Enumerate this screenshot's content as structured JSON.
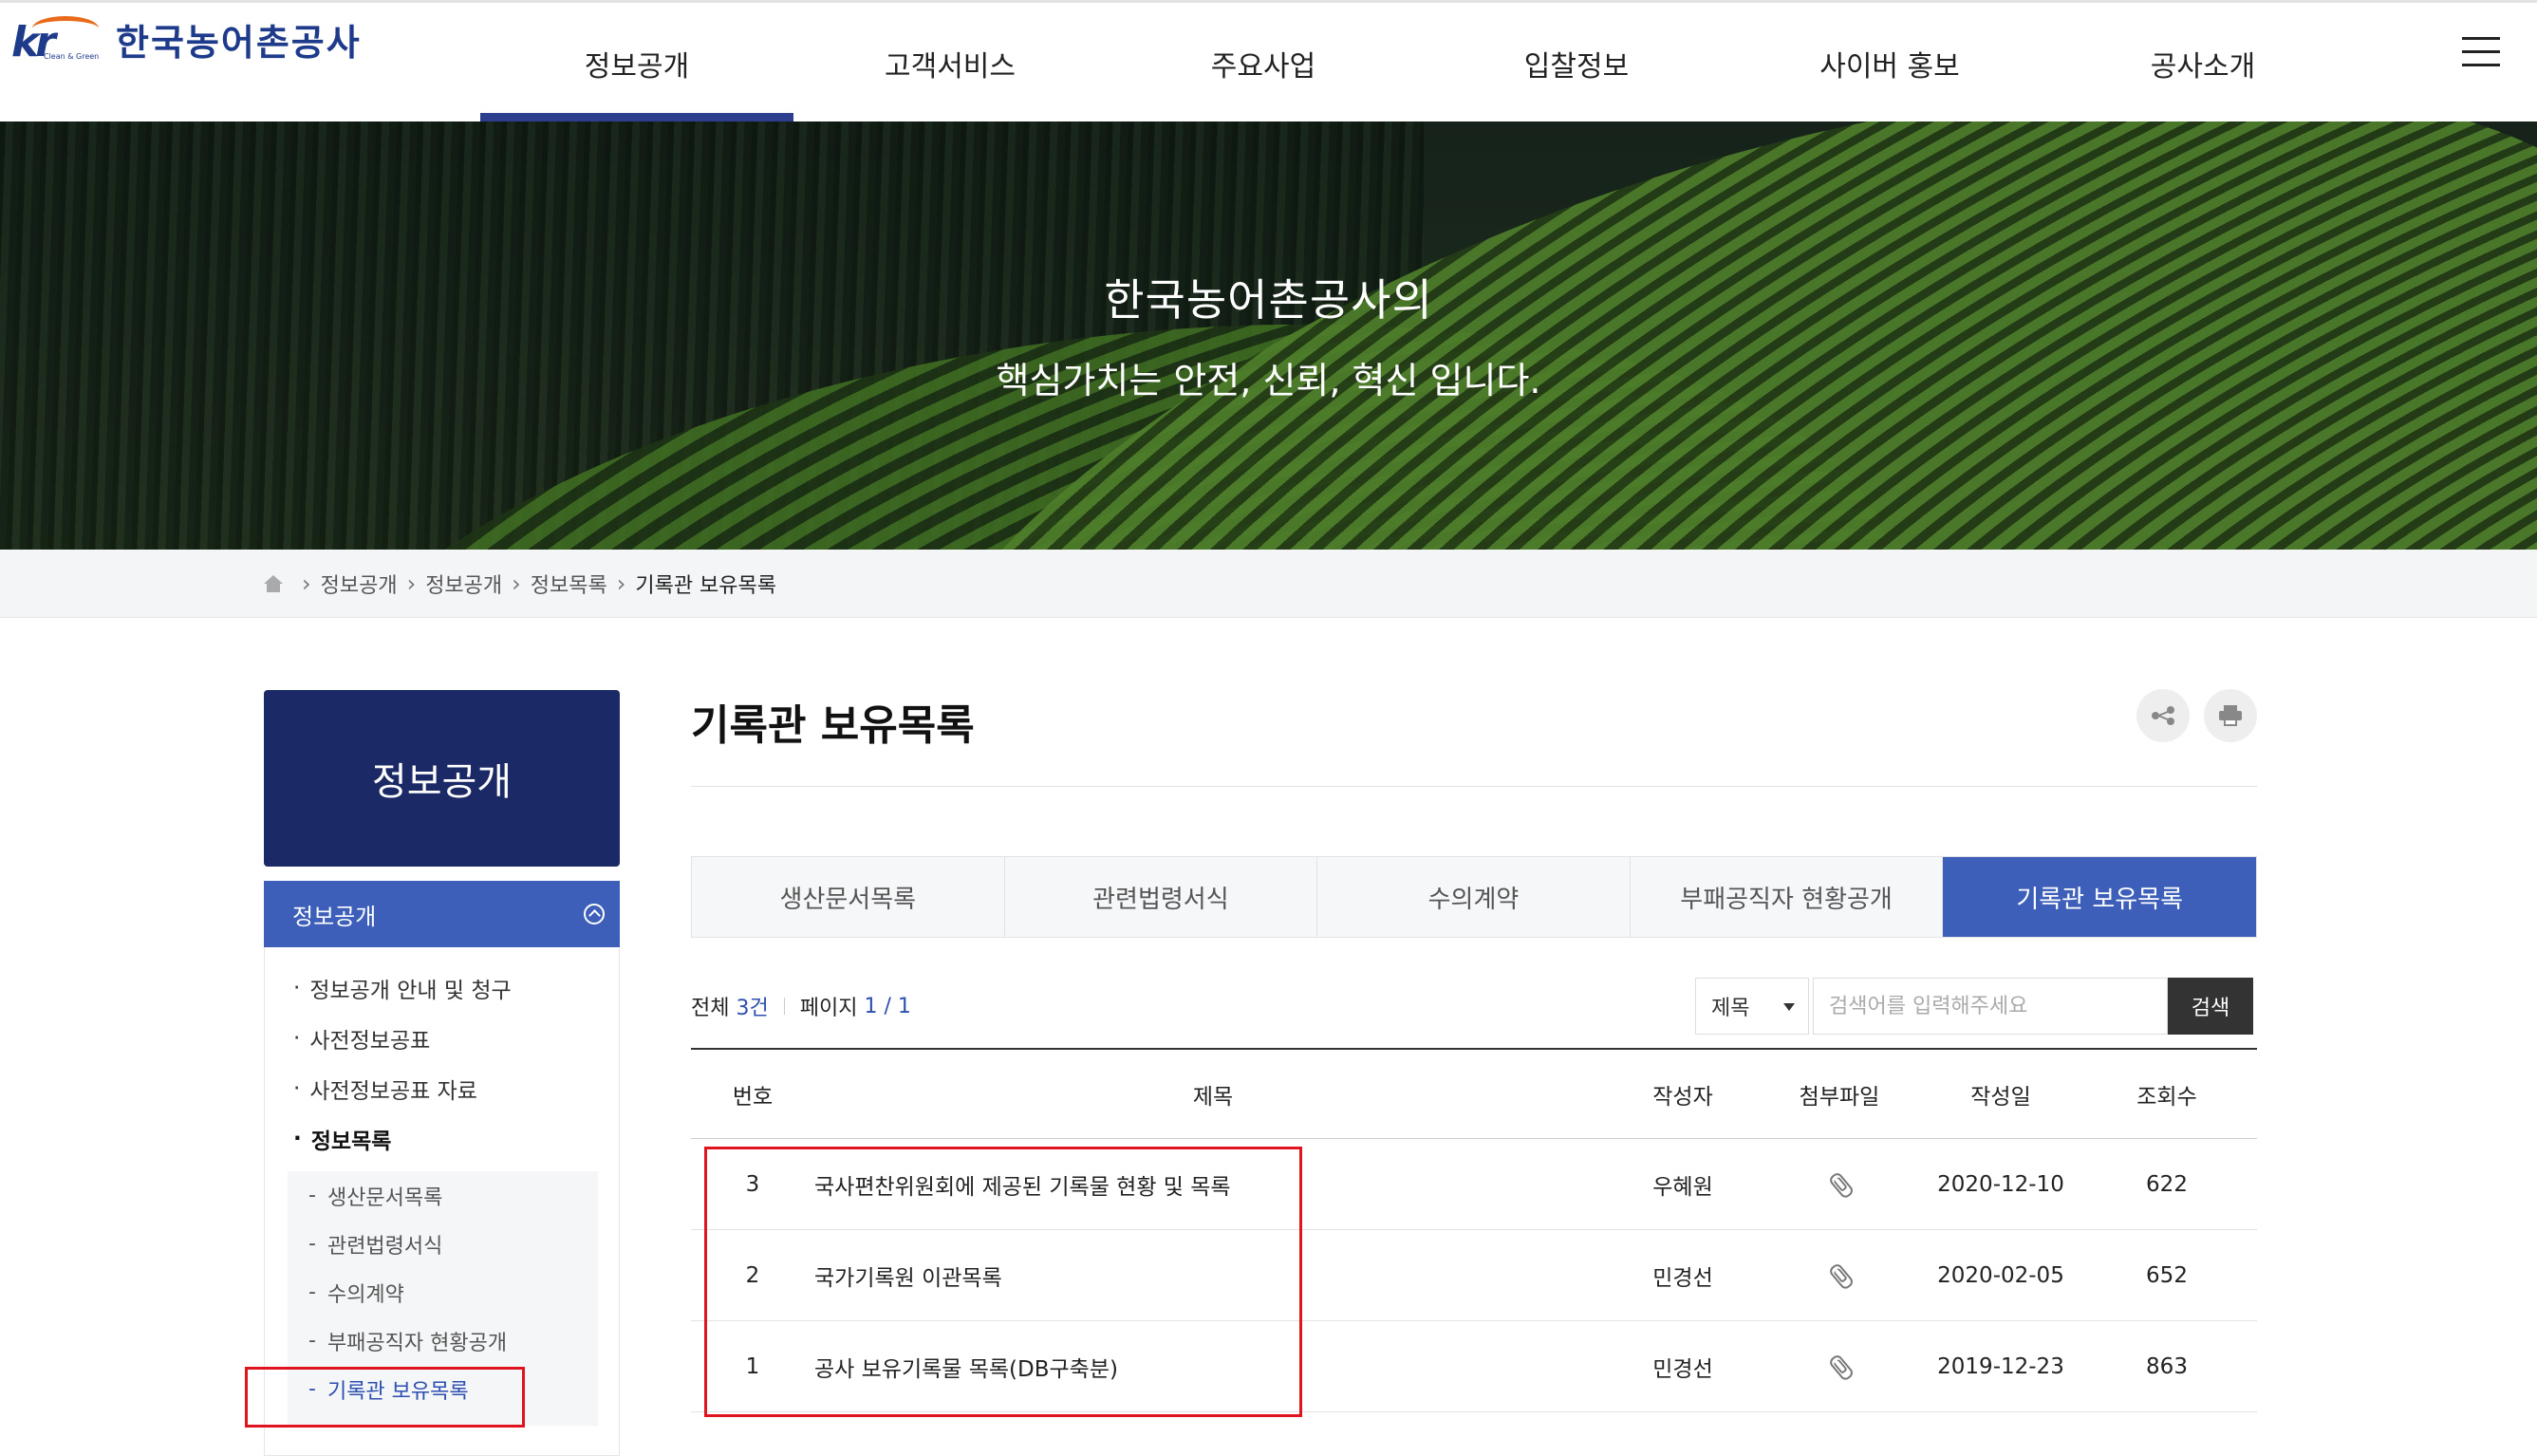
{
  "header": {
    "logo_mark": "kr",
    "logo_sub": "Clean & Green",
    "logo_text": "한국농어촌공사",
    "nav": [
      "정보공개",
      "고객서비스",
      "주요사업",
      "입찰정보",
      "사이버 홍보",
      "공사소개"
    ],
    "active_nav": "정보공개"
  },
  "banner": {
    "line1": "한국농어촌공사의",
    "line2": "핵심가치는 안전, 신뢰, 혁신 입니다."
  },
  "breadcrumb": [
    "정보공개",
    "정보공개",
    "정보목록",
    "기록관 보유목록"
  ],
  "sidebar": {
    "head": "정보공개",
    "category": "정보공개",
    "items": [
      {
        "label": "정보공개 안내 및 청구"
      },
      {
        "label": "사전정보공표"
      },
      {
        "label": "사전정보공표 자료"
      },
      {
        "label": "정보목록"
      }
    ],
    "sub_items": [
      {
        "label": "생산문서목록"
      },
      {
        "label": "관련법령서식"
      },
      {
        "label": "수의계약"
      },
      {
        "label": "부패공직자 현황공개"
      },
      {
        "label": "기록관 보유목록"
      }
    ]
  },
  "content": {
    "title": "기록관 보유목록",
    "tabs": [
      "생산문서목록",
      "관련법령서식",
      "수의계약",
      "부패공직자 현황공개",
      "기록관 보유목록"
    ],
    "active_tab": "기록관 보유목록",
    "count_prefix": "전체",
    "count_value": "3건",
    "page_prefix": "페이지",
    "page_current": "1",
    "page_sep": "/",
    "page_total": "1",
    "search": {
      "select_value": "제목",
      "placeholder": "검색어를 입력해주세요",
      "button": "검색"
    },
    "columns": [
      "번호",
      "제목",
      "작성자",
      "첨부파일",
      "작성일",
      "조회수"
    ],
    "rows": [
      {
        "no": "3",
        "title": "국사편찬위원회에 제공된 기록물 현황 및 목록",
        "author": "우혜원",
        "date": "2020-12-10",
        "views": "622"
      },
      {
        "no": "2",
        "title": "국가기록원 이관목록",
        "author": "민경선",
        "date": "2020-02-05",
        "views": "652"
      },
      {
        "no": "1",
        "title": "공사 보유기록물 목록(DB구축분)",
        "author": "민경선",
        "date": "2019-12-23",
        "views": "863"
      }
    ]
  },
  "colors": {
    "brand_navy": "#1b2a66",
    "accent_blue": "#3d5fb9",
    "annotation_red": "#e0141e"
  }
}
